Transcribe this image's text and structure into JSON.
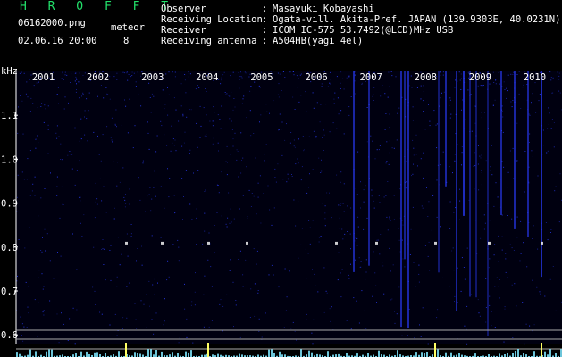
{
  "header": {
    "title": "H R O F F T",
    "file": "06162000.png",
    "meteor_label": "meteor",
    "datetime": "02.06.16 20:00",
    "meteor_count": "8",
    "rows": [
      {
        "label": "Observer",
        "value": "Masayuki Kobayashi"
      },
      {
        "label": "Receiving Location",
        "value": "Ogata-vill. Akita-Pref. JAPAN (139.9303E, 40.0231N)"
      },
      {
        "label": "Receiver",
        "value": "ICOM IC-575 53.7492(@LCD)MHz USB"
      },
      {
        "label": "Receiving antenna",
        "value": "A504HB(yagi 4el)"
      }
    ],
    "colon": ":"
  },
  "chart_data": {
    "type": "heatmap",
    "ylabel": "kHz",
    "ylim": [
      0.58,
      1.2
    ],
    "y_ticks": [
      "1.1",
      "1.0",
      "0.9",
      "0.8",
      "0.7",
      "0.6"
    ],
    "y_tick_values": [
      1.1,
      1.0,
      0.9,
      0.8,
      0.7,
      0.6
    ],
    "x_ticks": [
      "2001",
      "2002",
      "2003",
      "2004",
      "2005",
      "2006",
      "2007",
      "2008",
      "2009",
      "2010"
    ],
    "xlim": [
      2000.5,
      2010.5
    ],
    "colors": {
      "background": "#000010",
      "signal": "#2a3cff",
      "bright": "#ffffff",
      "meter": "#7fe8ff",
      "peak": "#ffff66"
    }
  }
}
